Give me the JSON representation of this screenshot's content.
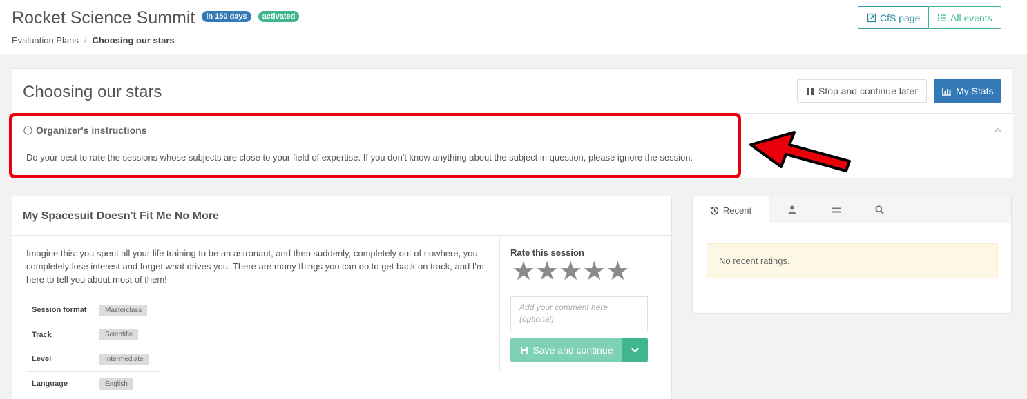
{
  "header": {
    "event_title": "Rocket Science Summit",
    "badge_days": "in 150 days",
    "badge_status": "activated",
    "breadcrumb": {
      "parent": "Evaluation Plans",
      "separator": "/",
      "current": "Choosing our stars"
    },
    "cfs_button": "CfS page",
    "all_events_button": "All events"
  },
  "plan": {
    "title": "Choosing our stars",
    "stop_button": "Stop and continue later",
    "stats_button": "My Stats"
  },
  "instructions": {
    "title": "Organizer's instructions",
    "text": "Do your best to rate the sessions whose subjects are close to your field of expertise. If you don't know anything about the subject in question, please ignore the session."
  },
  "session": {
    "title": "My Spacesuit Doesn't Fit Me No More",
    "abstract": "Imagine this: you spent all your life training to be an astronaut, and then suddenly, completely out of nowhere, you completely lose interest and forget what drives you. There are many things you can do to get back on track, and I'm here to tell you about most of them!",
    "meta": [
      {
        "key": "Session format",
        "value": "Masterclass"
      },
      {
        "key": "Track",
        "value": "Scientific"
      },
      {
        "key": "Level",
        "value": "Intermediate"
      },
      {
        "key": "Language",
        "value": "English"
      }
    ],
    "rate_label": "Rate this session",
    "rating": 0,
    "star_count": 5,
    "comment_placeholder": "Add your comment here (optional)",
    "save_button": "Save and continue"
  },
  "sidebar": {
    "tabs": [
      {
        "label": "Recent",
        "icon": "history-icon",
        "active": true
      },
      {
        "label": "",
        "icon": "user-icon",
        "active": false
      },
      {
        "label": "",
        "icon": "equals-icon",
        "active": false
      },
      {
        "label": "",
        "icon": "search-icon",
        "active": false
      }
    ],
    "empty_message": "No recent ratings."
  },
  "colors": {
    "primary": "#337ab7",
    "success": "#3fb68e",
    "annotation_red": "#e8000b",
    "warning_bg": "#fcf8e3"
  }
}
